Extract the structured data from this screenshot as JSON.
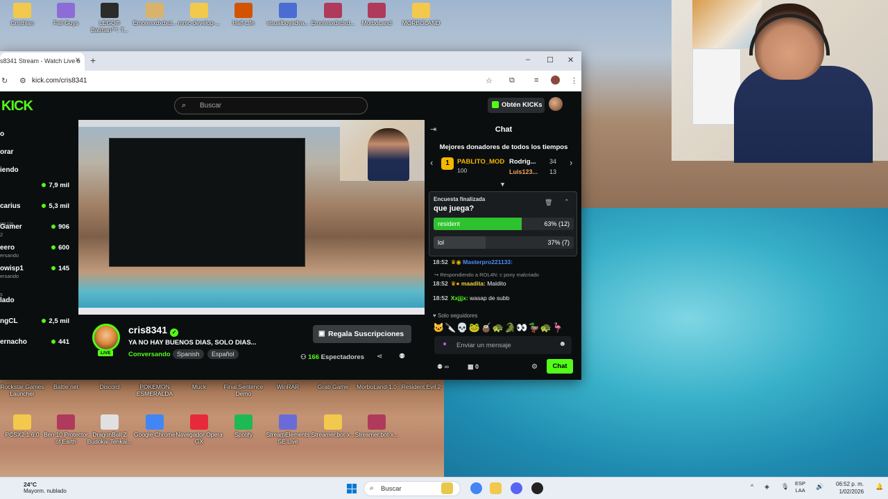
{
  "desktop": {
    "top_icons": [
      {
        "label": "Cristhian",
        "color": "#f2c94c"
      },
      {
        "label": "Fall Guys",
        "color": "#8e6cd8"
      },
      {
        "label": "LEGO® Batman™: T...",
        "color": "#2b2b2b"
      },
      {
        "label": "Emotesxdxdxd...",
        "color": "#d9b36a"
      },
      {
        "label": "mmc-develop-...",
        "color": "#f2c94c"
      },
      {
        "label": "Half-Life",
        "color": "#d35400"
      },
      {
        "label": "visualboyadva...",
        "color": "#4a6cd4"
      },
      {
        "label": "Emotesxdxdxd...",
        "color": "#b03a5b"
      },
      {
        "label": "MorboLand",
        "color": "#b03a5b"
      },
      {
        "label": "MORBOLAND",
        "color": "#f2c94c"
      }
    ],
    "row_icons": [
      {
        "label": "Rockstar Games Launcher"
      },
      {
        "label": "Battle.net"
      },
      {
        "label": "Discord"
      },
      {
        "label": "POKEMON ESMERALDA"
      },
      {
        "label": "Muck"
      },
      {
        "label": "Final Sentence Demo"
      },
      {
        "label": "WinRAR"
      },
      {
        "label": "Grab Game"
      },
      {
        "label": "MorboLand-1.0"
      },
      {
        "label": "Resident Evil 2"
      }
    ],
    "bottom_icons": [
      {
        "label": "PCSX2 1.6.0",
        "color": "#f2c94c"
      },
      {
        "label": "Ben 10 Protector of Earth",
        "color": "#b03a5b"
      },
      {
        "label": "DragonBall Z Budokai Tenkai...",
        "color": "#e0e0e0"
      },
      {
        "label": "Google Chrome",
        "color": "#4285f4"
      },
      {
        "label": "Navegador Opera GX",
        "color": "#e8293b"
      },
      {
        "label": "Spotify",
        "color": "#1db954"
      },
      {
        "label": "StreamElements SE.Live",
        "color": "#6b6bd8"
      },
      {
        "label": "Streamer.bot-x...",
        "color": "#f2c94c"
      },
      {
        "label": "Streamer.bot-x...",
        "color": "#b03a5b"
      }
    ]
  },
  "browser": {
    "tab_title": "s8341 Stream - Watch Live o",
    "new_tab": "+",
    "minimize": "–",
    "maximize": "☐",
    "close": "✕",
    "tab_close": "✕",
    "url": "kick.com/cris8341"
  },
  "kick": {
    "logo": "KICK",
    "search_placeholder": "Buscar",
    "get_kicks": "Obtén KICKs",
    "sidebar": {
      "nav": [
        "o",
        "orar",
        "iendo"
      ],
      "section_label": "ng Us",
      "channels": [
        {
          "name": "",
          "sub": "",
          "viewers": "7,9 mil"
        },
        {
          "name": "carius",
          "sub": "",
          "viewers": "5,3 mil"
        },
        {
          "name": "Gamer",
          "sub": "2",
          "viewers": "906"
        },
        {
          "name": "eero",
          "sub": "ersando",
          "viewers": "600"
        },
        {
          "name": "owisp1",
          "sub": "ersando",
          "viewers": "145"
        },
        {
          "name": "",
          "sub": "s",
          "viewers": ""
        },
        {
          "name": "lado",
          "sub": "",
          "viewers": ""
        },
        {
          "name": "ngCL",
          "sub": "",
          "viewers": "2,5 mil"
        },
        {
          "name": "ernacho",
          "sub": "",
          "viewers": "441"
        }
      ]
    },
    "channel": {
      "name": "cris8341",
      "title": "YA NO HAY BUENOS DIAS, SOLO DIAS...",
      "category": "Conversando",
      "tags": [
        "Spanish",
        "Español"
      ],
      "live": "LIVE",
      "gift_button": "Regala Suscripciones",
      "viewers_count": "166",
      "viewers_label": "Espectadores"
    },
    "chat": {
      "header": "Chat",
      "donors_title": "Mejores donadores de todos los tiempos",
      "donors": [
        {
          "rank": "1",
          "name": "PABLITO_MOD",
          "amount": "100"
        },
        {
          "name": "Rodrig...",
          "amount": "34"
        },
        {
          "name": "Luis123...",
          "amount": "13"
        }
      ],
      "poll": {
        "status": "Encuesta finalizada",
        "question": "que juega?",
        "options": [
          {
            "label": "resident",
            "result": "63% (12)",
            "percent": 63,
            "color": "#2ec22e"
          },
          {
            "label": "lol",
            "result": "37% (7)",
            "percent": 37,
            "color": "#3a3d40"
          }
        ]
      },
      "messages": [
        {
          "time": "18:52",
          "user": "Masterpro221133:",
          "text": "",
          "user_class": "u1"
        },
        {
          "reply": "Respondiendo a ROL4N: c pony malcriado"
        },
        {
          "time": "18:52",
          "user": "maadita:",
          "text": "Maldito",
          "user_class": "u2"
        },
        {
          "time": "18:52",
          "user": "Xxjjjx:",
          "text": "wasap de subb",
          "user_class": "u3"
        }
      ],
      "followers_only": "Solo seguidores",
      "emotes": "🐱🔪💀🐸🧉🐢🐊👀🦆🐢🦩",
      "input_placeholder": "Enviar un mensaje",
      "points": "∞",
      "box_count": "0",
      "send": "Chat"
    }
  },
  "taskbar": {
    "temperature": "24°C",
    "weather": "Mayorm. nublado",
    "search": "Buscar",
    "lang_top": "ESP",
    "lang_bottom": "LAA",
    "time": "06:52 p. m.",
    "date": "1/02/2026"
  }
}
